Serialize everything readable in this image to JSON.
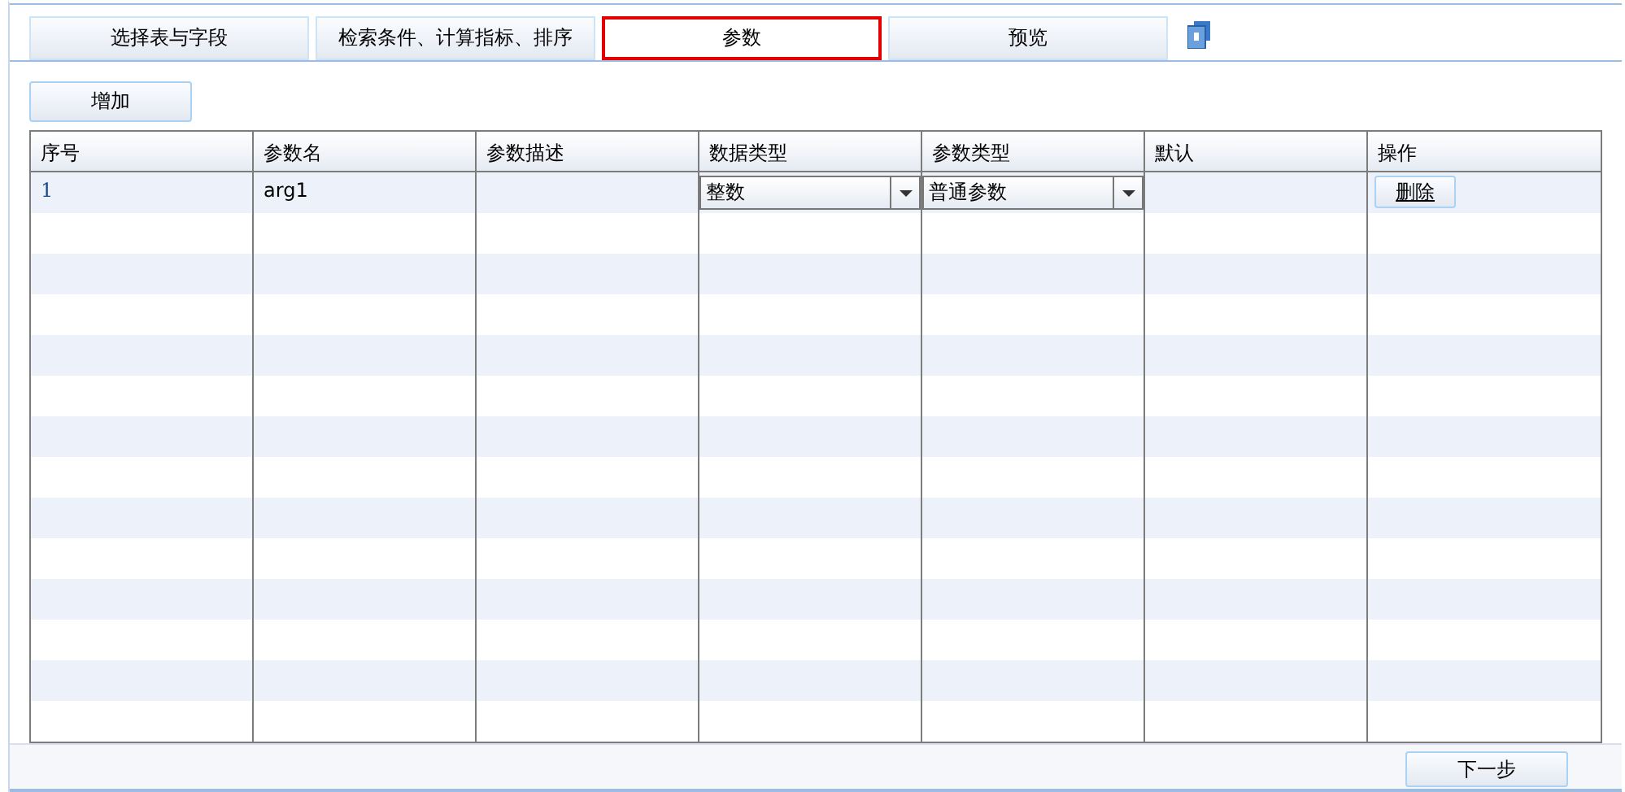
{
  "tabs": [
    {
      "label": "选择表与字段",
      "selected": false
    },
    {
      "label": "检索条件、计算指标、排序",
      "selected": false
    },
    {
      "label": "参数",
      "selected": true
    },
    {
      "label": "预览",
      "selected": false
    }
  ],
  "add_button": "增加",
  "table": {
    "columns": [
      "序号",
      "参数名",
      "参数描述",
      "数据类型",
      "参数类型",
      "默认",
      "操作"
    ],
    "rows": [
      {
        "index": "1",
        "name": "arg1",
        "data_type": "整数",
        "param_type": "普通参数",
        "action": "删除"
      }
    ]
  },
  "next_button": "下一步"
}
